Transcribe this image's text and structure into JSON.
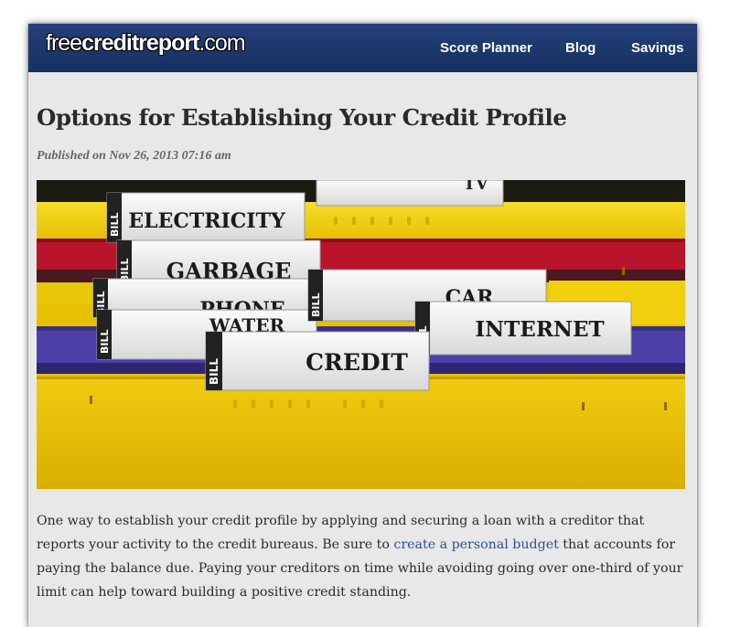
{
  "header": {
    "logo": {
      "part1": "free",
      "part2": "creditreport",
      "part3": ".com"
    },
    "nav": [
      "Score Planner",
      "Blog",
      "Savings"
    ]
  },
  "article": {
    "title": "Options for Establishing Your Credit Profile",
    "published": "Published on Nov 26, 2013 07:16 am",
    "image": {
      "tab_labels": [
        "TV",
        "ELECTRICITY",
        "GARBAGE",
        "PHONE",
        "WATER",
        "CAR",
        "INTERNET",
        "CREDIT"
      ],
      "bill_label": "BILL"
    },
    "paragraph": {
      "before_link": "One way to establish your credit profile by applying and securing a loan with a creditor that reports your activity to the credit bureaus. Be sure to ",
      "link": "create a personal budget",
      "after_link": " that accounts for paying the balance due. Paying your creditors on time while avoiding going over one-third of your limit can help toward building a positive credit standing."
    }
  },
  "colors": {
    "navbar": "#1d3869",
    "folder_yellow": "#f2cf0c",
    "folder_red": "#b8142c",
    "folder_purple": "#4d3fa8",
    "link": "#2f4f8f"
  }
}
